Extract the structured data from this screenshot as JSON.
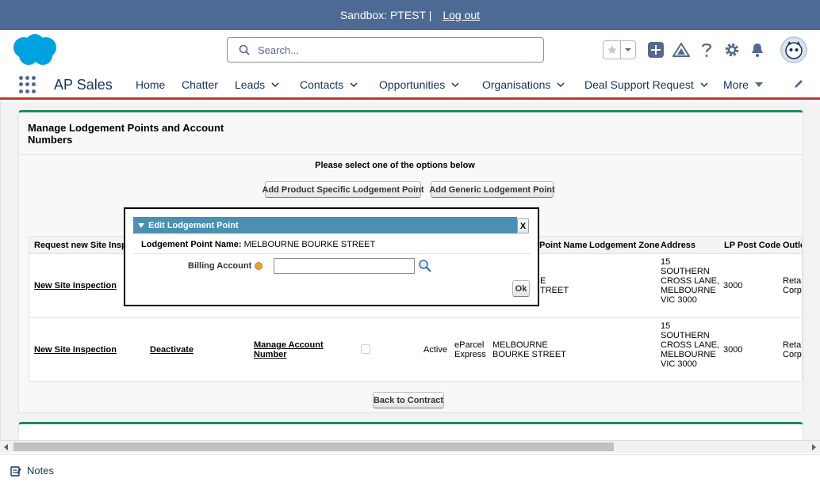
{
  "sandbox": {
    "label": "Sandbox: PTEST |",
    "logout": "Log out"
  },
  "header": {
    "search_placeholder": "Search..."
  },
  "nav": {
    "app_name": "AP Sales",
    "items": [
      {
        "label": "Home",
        "has_menu": false
      },
      {
        "label": "Chatter",
        "has_menu": false
      },
      {
        "label": "Leads",
        "has_menu": true
      },
      {
        "label": "Contacts",
        "has_menu": true
      },
      {
        "label": "Opportunities",
        "has_menu": true
      },
      {
        "label": "Organisations",
        "has_menu": true
      },
      {
        "label": "Deal Support Request",
        "has_menu": true
      },
      {
        "label": "More",
        "has_menu": true
      }
    ]
  },
  "panel": {
    "title": "Manage Lodgement Points and Account Numbers",
    "instructions": "Please select one of the options below",
    "add_product_btn": "Add Product Specific Lodgement Point",
    "add_generic_btn": "Add Generic Lodgement Point",
    "back_btn": "Back to Contract"
  },
  "table": {
    "headers": {
      "request": "Request new Site Inspection",
      "lp_name": "Point Name",
      "zone": "Lodgement Zone",
      "address": "Address",
      "post_code": "LP Post Code",
      "outlet": "Outlet Type"
    },
    "rows": [
      {
        "request": "New Site Inspection",
        "lp_name_line1": "E",
        "lp_name_line2": "TREET",
        "address": "15 SOUTHERN CROSS LANE, MELBOURNE VIC 3000",
        "post_code": "3000",
        "outlet": "Retail - Corp"
      },
      {
        "request": "New Site Inspection",
        "deactivate": "Deactivate",
        "manage_account": "Manage Account Number",
        "status": "Active",
        "product_line1": "eParcel",
        "product_line2": "Express",
        "lp_name_line1": "MELBOURNE",
        "lp_name_line2": "BOURKE STREET",
        "address": "15 SOUTHERN CROSS LANE, MELBOURNE VIC 3000",
        "post_code": "3000",
        "outlet": "Retail - Corp"
      }
    ]
  },
  "dialog": {
    "title": "Edit Lodgement Point",
    "close": "X",
    "lp_label": "Lodgement Point Name:",
    "lp_value": "MELBOURNE BOURKE STREET",
    "billing_label": "Billing Account",
    "billing_value": "",
    "ok": "Ok"
  },
  "utility": {
    "notes": "Notes"
  },
  "colors": {
    "sandbox_bar": "#4d6a95",
    "brand_blue": "#00a1e0",
    "nav_accent": "#c23934",
    "panel_accent": "#1f8a5c",
    "dialog_header": "#4b8fb3"
  }
}
